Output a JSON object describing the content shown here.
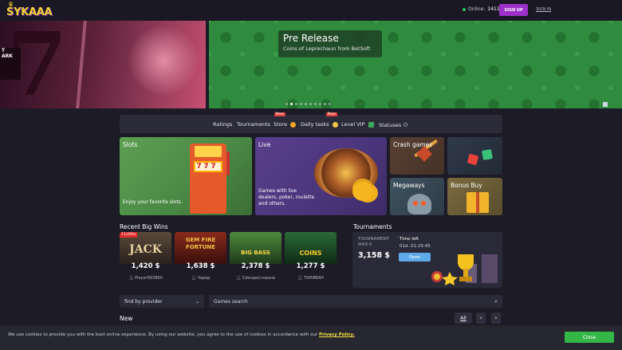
{
  "header": {
    "logo_text": "SYKAAA",
    "online_label": "Online:",
    "online_count": "2411",
    "signup_label": "SIGN UP",
    "signin_label": "SIGN IN"
  },
  "hero": {
    "left_text_1": "T",
    "left_text_2": "ARK",
    "title": "Pre Release",
    "subtitle": "Coins of Leprechaun from BetSoft",
    "slide_count": 10,
    "active_slide": 2
  },
  "nav": {
    "ratings": "Ratings",
    "tournaments": "Tournaments",
    "store": "Store",
    "store_badge": "New",
    "daily_tasks": "Daily tasks",
    "daily_badge": "New",
    "level_vip": "Level VIP",
    "statuses": "Statuses"
  },
  "categories": {
    "slots": {
      "label": "Slots",
      "desc": "Enjoy your favorite slots."
    },
    "live": {
      "label": "Live",
      "desc": "Games with live dealers, poker, roulette and others."
    },
    "crash": {
      "label": "Crash games"
    },
    "megaways": {
      "label": "Megaways"
    },
    "bonus_buy": {
      "label": "Bonus Buy"
    }
  },
  "recent_wins": {
    "title": "Recent Big Wins",
    "items": [
      {
        "game": "JACK",
        "amount": "1,420 $",
        "player": "Player993860",
        "multiplier": "13,000x",
        "art": "#7a5a3a"
      },
      {
        "game": "GEM FIRE FORTUNE",
        "amount": "1,638 $",
        "player": "Чарар",
        "art": "#6a1f1f"
      },
      {
        "game": "BIG BASS",
        "amount": "2,378 $",
        "player": "Сёенри(снашна",
        "art": "#3d7a3a"
      },
      {
        "game": "COINS",
        "amount": "1,277 $",
        "player": "ТИЛИВАН",
        "art": "#1f5a2e"
      }
    ]
  },
  "tournaments": {
    "title": "Tournaments",
    "name_1": "TOURNAMENT",
    "name_2": "MAX-X",
    "amount": "3,158 $",
    "time_label": "Time left",
    "time_value": "01d. 01:25:45",
    "open_label": "Open"
  },
  "filters": {
    "provider_placeholder": "find by provider",
    "search_placeholder": "Games search"
  },
  "new_section": {
    "title": "New",
    "all_label": "All"
  },
  "cookie": {
    "text": "We use cookies to provide you with the best online experience. By using our website, you agree to the use of cookies in accordance with our",
    "link": "Privacy Policy.",
    "close_label": "Close"
  }
}
